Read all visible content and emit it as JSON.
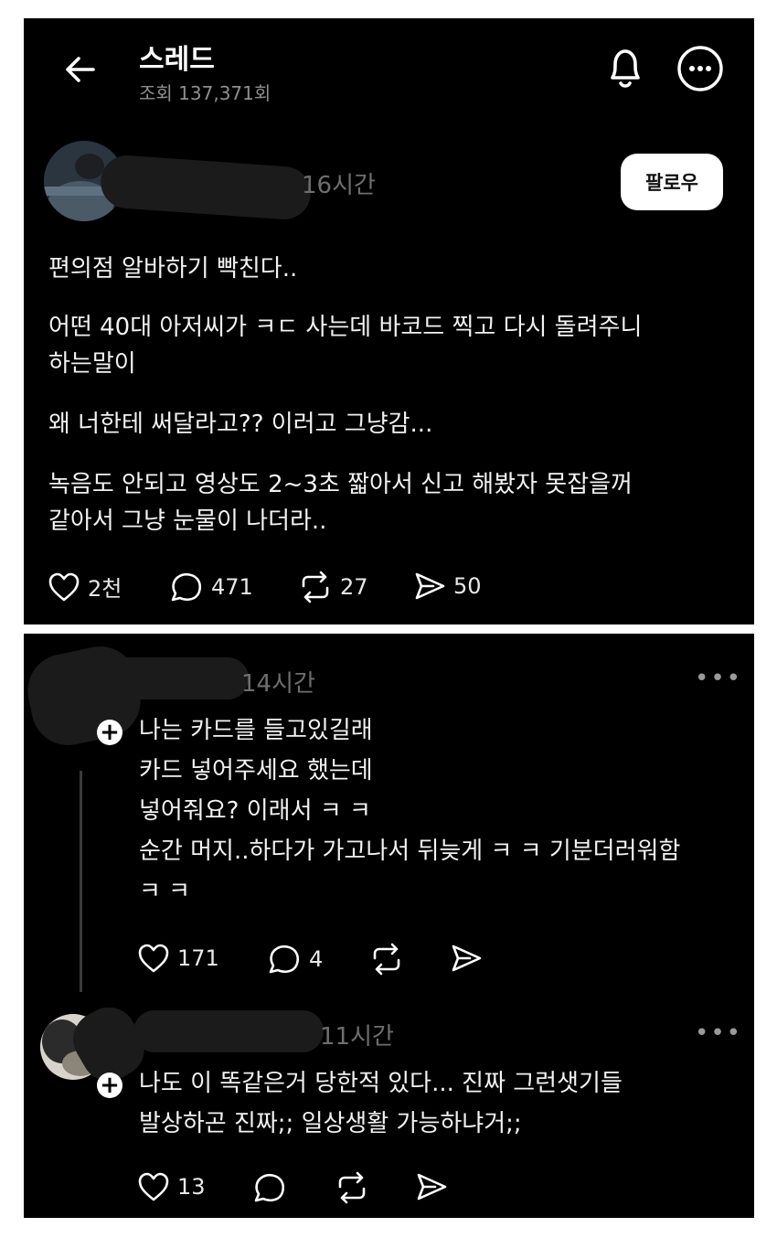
{
  "header": {
    "title": "스레드",
    "views": "조회 137,371회"
  },
  "post": {
    "time": "16시간",
    "follow_label": "팔로우",
    "lines": [
      "편의점 알바하기 빡친다..",
      "어떤 40대 아저씨가 ㅋㄷ 사는데 바코드 찍고 다시 돌려주니",
      "하는말이",
      "왜 너한테 써달라고?? 이러고 그냥감...",
      "녹음도 안되고 영상도 2~3초 짧아서 신고 해봤자 못잡을꺼",
      "같아서 그냥 눈물이 나더라.."
    ],
    "likes": "2천",
    "comments": "471",
    "reposts": "27",
    "shares": "50"
  },
  "reply1": {
    "time": "14시간",
    "lines": [
      "나는 카드를 들고있길래",
      "카드 넣어주세요 했는데",
      "넣어줘요? 이래서 ㅋ ㅋ",
      "순간 머지..하다가 가고나서 뒤늦게 ㅋ ㅋ 기분더러워함",
      "ㅋ ㅋ"
    ],
    "likes": "171",
    "comments": "4"
  },
  "reply2": {
    "time": "11시간",
    "lines": [
      "나도 이 똑같은거 당한적 있다... 진짜 그런샛기들",
      "발상하곤 진짜;; 일상생활 가능하냐거;;"
    ],
    "likes": "13"
  },
  "icons": {
    "back": "back-arrow-icon",
    "bell": "bell-icon",
    "more": "more-icon",
    "heart": "heart-icon",
    "comment": "comment-icon",
    "repost": "repost-icon",
    "share": "share-icon",
    "plus": "plus-icon"
  },
  "colors": {
    "background": "#000000",
    "text": "#f2f2f2",
    "muted": "#6e6e6e",
    "button_bg": "#ffffff"
  }
}
